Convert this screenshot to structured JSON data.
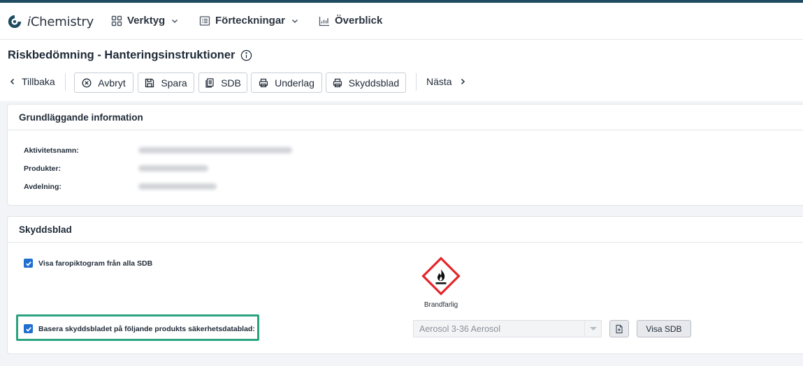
{
  "app": {
    "brand_i": "i",
    "brand_rest": "Chemistry"
  },
  "nav": [
    {
      "label": "Verktyg",
      "icon": "grid-icon",
      "has_dropdown": true
    },
    {
      "label": "Förteckningar",
      "icon": "list-icon",
      "has_dropdown": true
    },
    {
      "label": "Överblick",
      "icon": "chart-icon",
      "has_dropdown": false
    }
  ],
  "page": {
    "title": "Riskbedömning - Hanteringsinstruktioner"
  },
  "toolbar": {
    "back_label": "Tillbaka",
    "buttons": [
      {
        "label": "Avbryt",
        "icon": "cancel-icon"
      },
      {
        "label": "Spara",
        "icon": "save-icon"
      },
      {
        "label": "SDB",
        "icon": "document-copy-icon"
      },
      {
        "label": "Underlag",
        "icon": "printer-icon"
      },
      {
        "label": "Skyddsblad",
        "icon": "printer-icon"
      }
    ],
    "next_label": "Nästa"
  },
  "basic_info": {
    "header": "Grundläggande information",
    "fields": [
      {
        "label": "Aktivitetsnamn:"
      },
      {
        "label": "Produkter:"
      },
      {
        "label": "Avdelning:"
      }
    ]
  },
  "protection_sheet": {
    "header": "Skyddsblad",
    "show_pictograms_label": "Visa faropiktogram från alla SDB",
    "show_pictograms_checked": true,
    "pictogram_label": "Brandfarlig",
    "pictogram_icon": "flame-hazard-icon",
    "base_on_product_label": "Basera skyddsbladet på följande produkts säkerhetsdatablad:",
    "base_on_product_checked": true,
    "product_select_value": "Aerosol 3-36 Aerosol",
    "show_sdb_label": "Visa SDB"
  },
  "colors": {
    "accent_bar": "#1e4b61",
    "checkbox": "#1f6fd1",
    "highlight": "#2aa37f",
    "hazard_red": "#e3262b"
  }
}
